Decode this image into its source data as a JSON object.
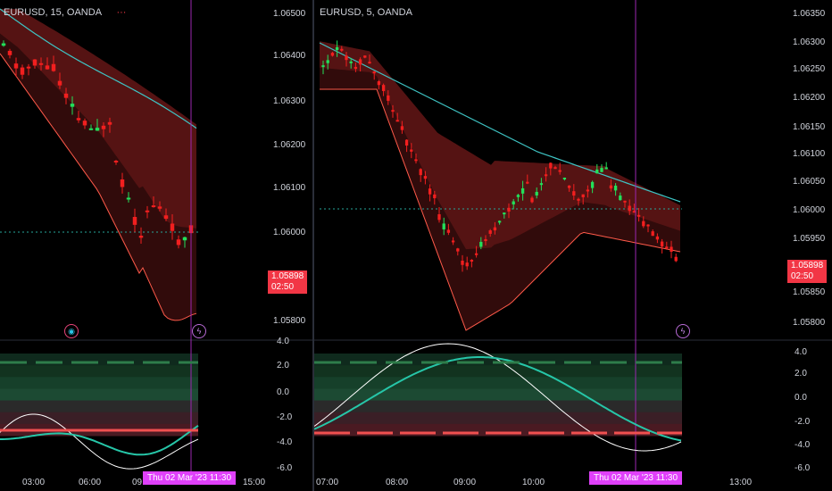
{
  "left_chart": {
    "symbol": "EURUSD, 15, OANDA",
    "price_ticks": [
      "1.06500",
      "1.06400",
      "1.06300",
      "1.06200",
      "1.06100",
      "1.06000",
      "1.05800"
    ],
    "current_price": "1.05898",
    "countdown": "02:50",
    "osc_ticks": [
      "4.0",
      "2.0",
      "0.0",
      "-2.0",
      "-4.0",
      "-6.0"
    ],
    "time_ticks": [
      "03:00",
      "06:00",
      "09",
      "15:00"
    ],
    "crosshair_time": "Thu 02 Mar '23   11:30",
    "indicator_menu": "···"
  },
  "right_chart": {
    "symbol": "EURUSD, 5, OANDA",
    "price_ticks": [
      "1.06350",
      "1.06300",
      "1.06250",
      "1.06200",
      "1.06150",
      "1.06100",
      "1.06050",
      "1.06000",
      "1.05950",
      "1.05850",
      "1.05800"
    ],
    "current_price": "1.05898",
    "countdown": "02:50",
    "osc_ticks": [
      "4.0",
      "2.0",
      "0.0",
      "-2.0",
      "-4.0",
      "-6.0"
    ],
    "time_ticks": [
      "07:00",
      "08:00",
      "09:00",
      "10:00",
      "13:00"
    ],
    "crosshair_time": "Thu 02 Mar '23   11:30"
  },
  "icons": [
    "globe-icon",
    "lightning-icon"
  ],
  "colors": {
    "bull": "#22e05a",
    "bear": "#f21f1f",
    "cyan": "#3ec5c5",
    "crosshair": "#9c27b0",
    "tag_magenta": "#e040fb",
    "price_tag": "#f23645",
    "osc_white": "#ffffff",
    "osc_teal": "#26c6a8",
    "dotted_level": "#26a69a"
  }
}
